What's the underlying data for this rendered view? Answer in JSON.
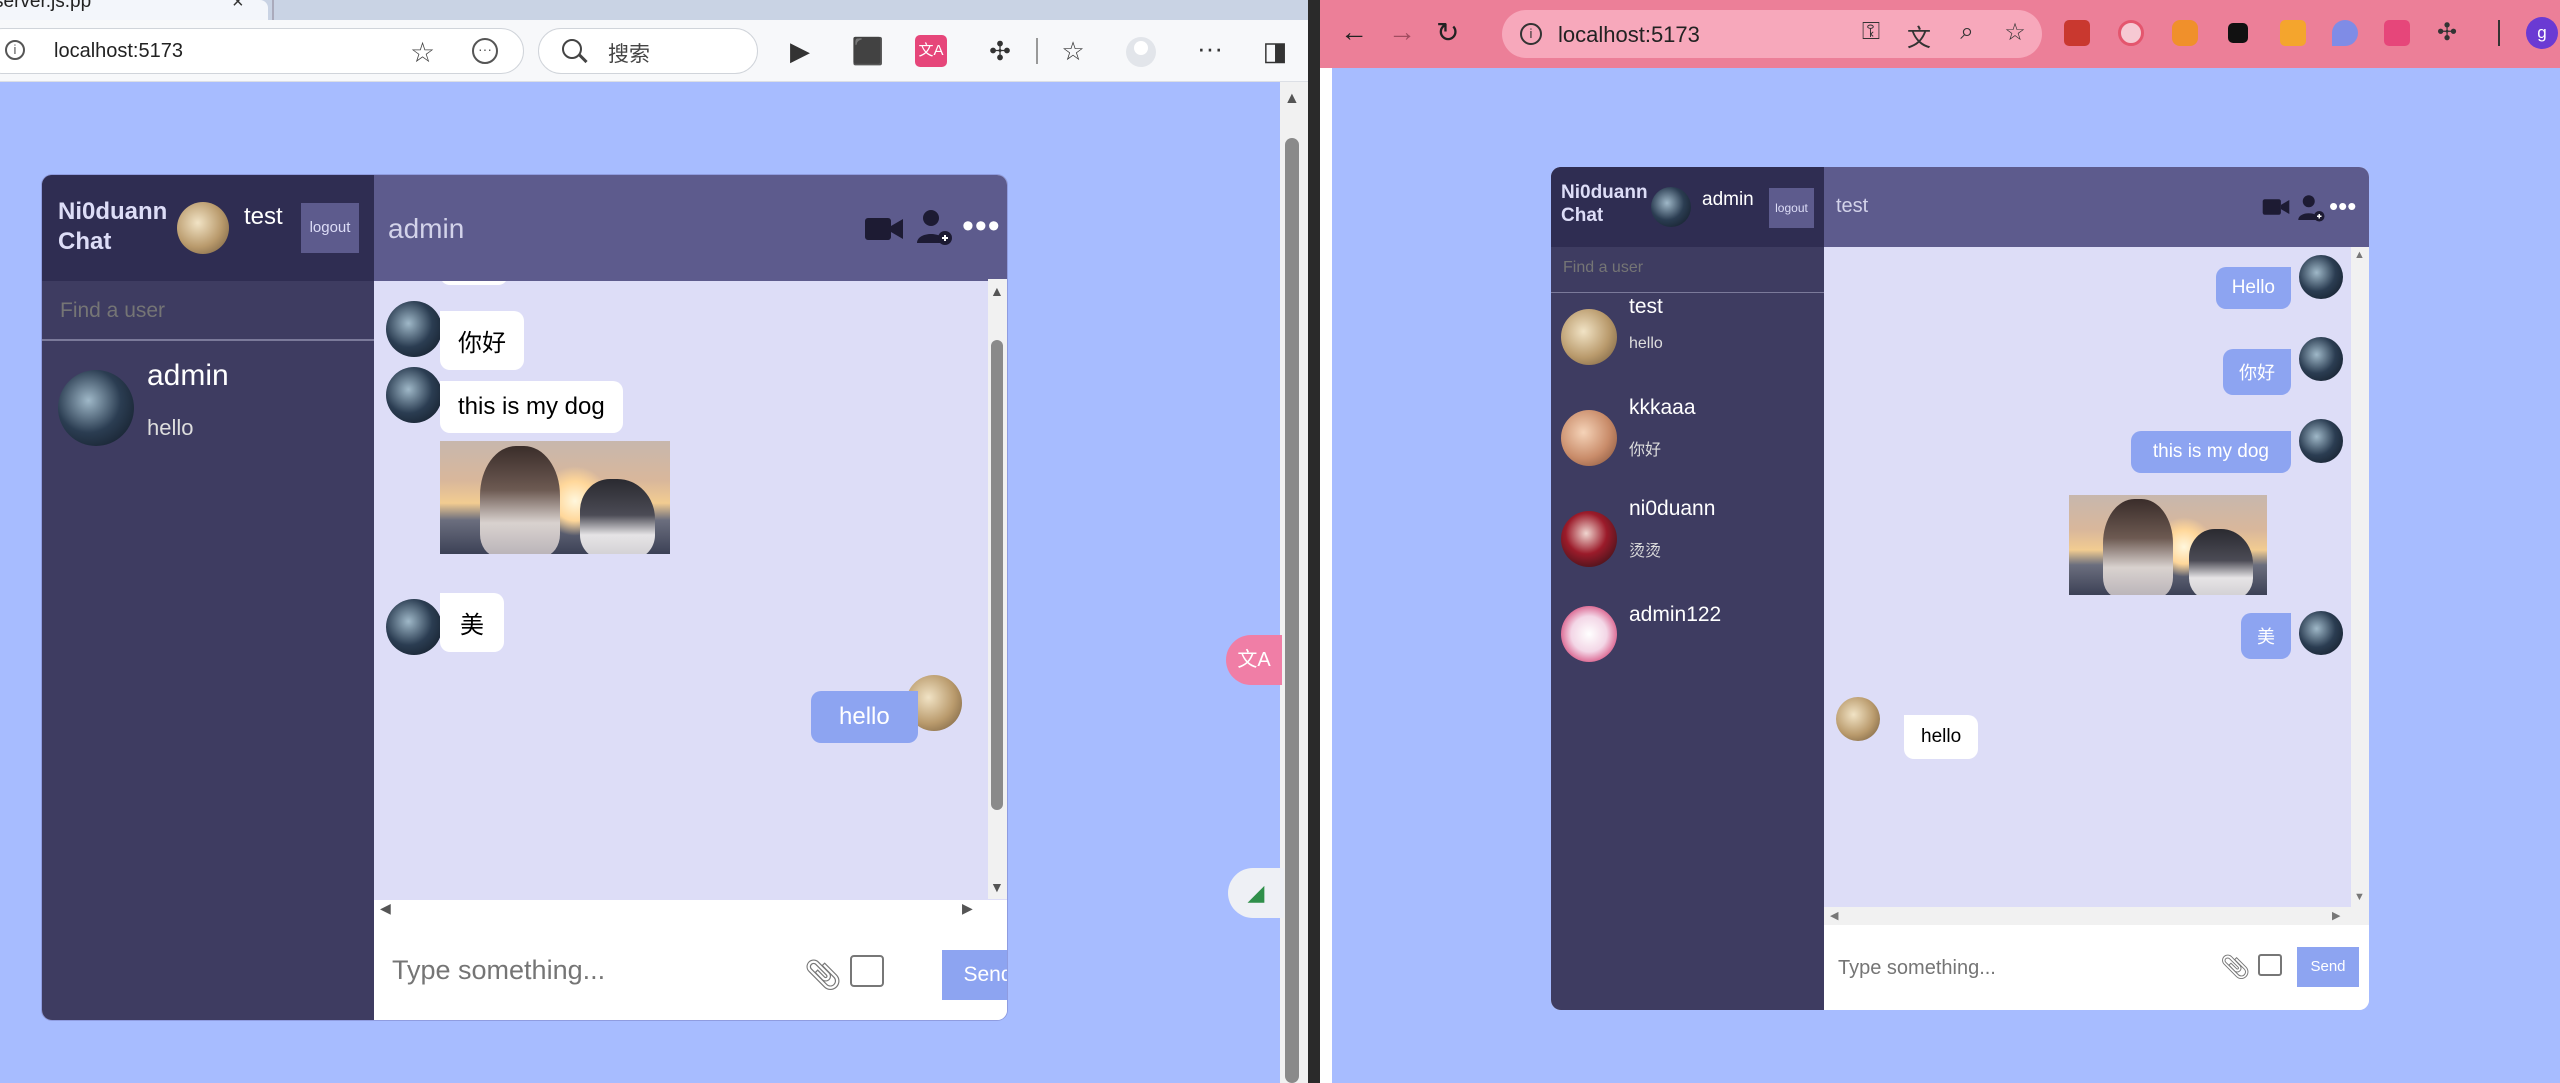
{
  "left_browser": {
    "tab_title": "server.js.pp",
    "tab_close": "×",
    "address": "localhost:5173",
    "search_placeholder": "搜索",
    "icons": [
      "info-icon",
      "star-icon",
      "more-circle-icon",
      "search-icon",
      "play-icon",
      "extension-icon",
      "translate-extension-icon",
      "puzzle-icon",
      "favorites-icon",
      "profile-icon",
      "more-icon",
      "sidebar-icon"
    ],
    "translate_badge": "文A"
  },
  "left_app": {
    "logo": "Ni0duann Chat",
    "current_user": "test",
    "logout_label": "logout",
    "search_placeholder": "Find a user",
    "chats": [
      {
        "name": "admin",
        "last_message": "hello"
      }
    ],
    "chat_header": "admin",
    "messages": [
      {
        "from": "admin",
        "owner": false,
        "text": "你好"
      },
      {
        "from": "admin",
        "owner": false,
        "text": "this is my dog"
      },
      {
        "from": "admin",
        "owner": false,
        "image": "girl-and-husky-photo"
      },
      {
        "from": "admin",
        "owner": false,
        "text": "美"
      },
      {
        "from": "test",
        "owner": true,
        "text": "hello"
      }
    ],
    "input_placeholder": "Type something...",
    "send_label": "Send"
  },
  "right_browser": {
    "address": "localhost:5173",
    "profile_letter": "g",
    "icons": [
      "back-icon",
      "forward-icon",
      "reload-icon",
      "info-icon",
      "key-icon",
      "translate-icon",
      "zoom-icon",
      "star-icon",
      "puzzle-icon"
    ]
  },
  "right_app": {
    "logo": "Ni0duann Chat",
    "current_user": "admin",
    "logout_label": "logout",
    "search_placeholder": "Find a user",
    "chats": [
      {
        "name": "test",
        "last_message": "hello"
      },
      {
        "name": "kkkaaa",
        "last_message": "你好"
      },
      {
        "name": "ni0duann",
        "last_message": "烫烫"
      },
      {
        "name": "admin122",
        "last_message": ""
      }
    ],
    "chat_header": "test",
    "messages": [
      {
        "from": "admin",
        "owner": true,
        "text": "Hello"
      },
      {
        "from": "admin",
        "owner": true,
        "text": "你好"
      },
      {
        "from": "admin",
        "owner": true,
        "text": "this is my dog"
      },
      {
        "from": "admin",
        "owner": true,
        "image": "girl-and-husky-photo"
      },
      {
        "from": "admin",
        "owner": true,
        "text": "美"
      },
      {
        "from": "test",
        "owner": false,
        "text": "hello"
      }
    ],
    "input_placeholder": "Type something...",
    "send_label": "Send"
  },
  "colors": {
    "page_bg": "#a7bcff",
    "sidebar": "#3e3c61",
    "navbar": "#2f2d52",
    "chat_header": "#5d5b8d",
    "chat_bg": "#ddddf7",
    "owner_bubble": "#8da4f1",
    "right_browser_toolbar": "#ec7f98"
  }
}
